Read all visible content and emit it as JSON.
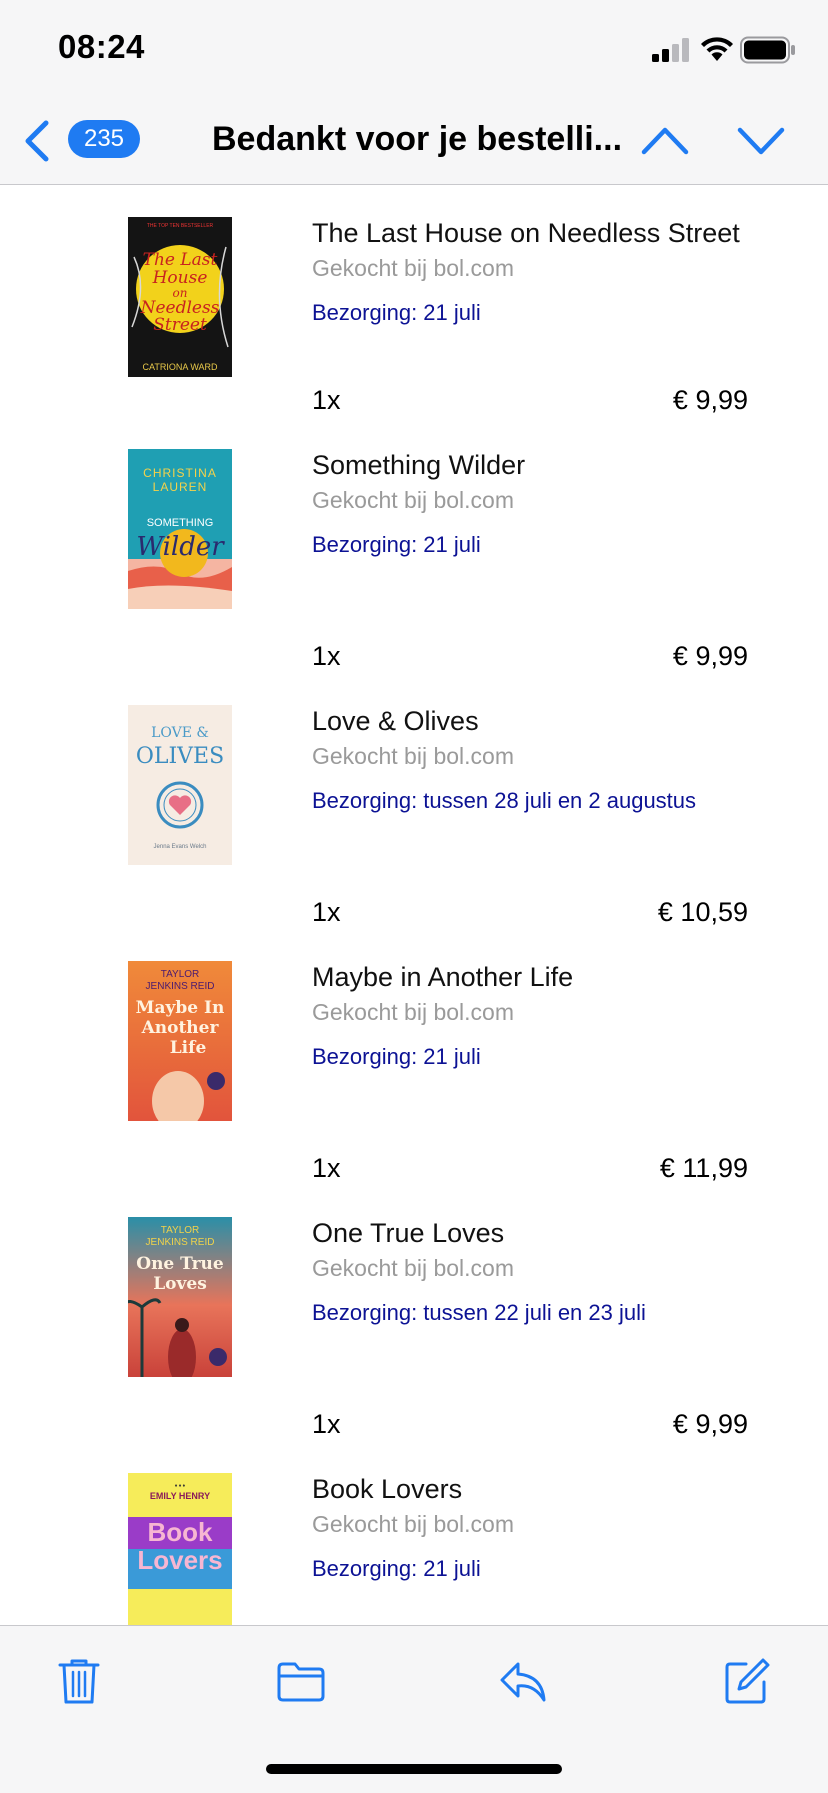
{
  "status_bar": {
    "time": "08:24"
  },
  "nav": {
    "unread_count": "235",
    "title": "Bedankt voor je bestelli..."
  },
  "items": [
    {
      "title": "The Last House on Needless Street",
      "seller": "Gekocht bij bol.com",
      "delivery": "Bezorging: 21 juli",
      "qty": "1x",
      "price": "€ 9,99",
      "cover": {
        "line1": "The Last",
        "line2": "House",
        "line3": "on",
        "line4": "Needless",
        "line5": "Street",
        "author": "CATRIONA WARD",
        "banner": "THE TOP TEN BESTSELLER"
      }
    },
    {
      "title": "Something Wilder",
      "seller": "Gekocht bij bol.com",
      "delivery": "Bezorging: 21 juli",
      "qty": "1x",
      "price": "€ 9,99",
      "cover": {
        "author1": "CHRISTINA",
        "author2": "LAUREN",
        "line1": "SOMETHING",
        "line2": "Wilder"
      }
    },
    {
      "title": "Love & Olives",
      "seller": "Gekocht bij bol.com",
      "delivery": "Bezorging: tussen 28 juli en 2 augustus",
      "qty": "1x",
      "price": "€ 10,59",
      "cover": {
        "line1": "LOVE &",
        "line2": "OLIVES",
        "author": "Jenna Evans Welch"
      }
    },
    {
      "title": "Maybe in Another Life",
      "seller": "Gekocht bij bol.com",
      "delivery": "Bezorging: 21 juli",
      "qty": "1x",
      "price": "€ 11,99",
      "cover": {
        "author1": "TAYLOR",
        "author2": "JENKINS REID",
        "line1": "Maybe In",
        "line2": "Another",
        "line3": "Life"
      }
    },
    {
      "title": "One True Loves",
      "seller": "Gekocht bij bol.com",
      "delivery": "Bezorging: tussen 22 juli en 23 juli",
      "qty": "1x",
      "price": "€ 9,99",
      "cover": {
        "author1": "TAYLOR",
        "author2": "JENKINS REID",
        "line1": "One True",
        "line2": "Loves"
      }
    },
    {
      "title": "Book Lovers",
      "seller": "Gekocht bij bol.com",
      "delivery": "Bezorging: 21 juli",
      "cover": {
        "author": "EMILY HENRY",
        "line1": "Book",
        "line2": "Lovers"
      }
    }
  ],
  "toolbar": {
    "icons": [
      "trash-icon",
      "folder-icon",
      "reply-icon",
      "compose-icon"
    ]
  },
  "colors": {
    "accent": "#1f7bf2",
    "delivery_text": "#0c1294",
    "seller_text": "#9a9a9a"
  }
}
